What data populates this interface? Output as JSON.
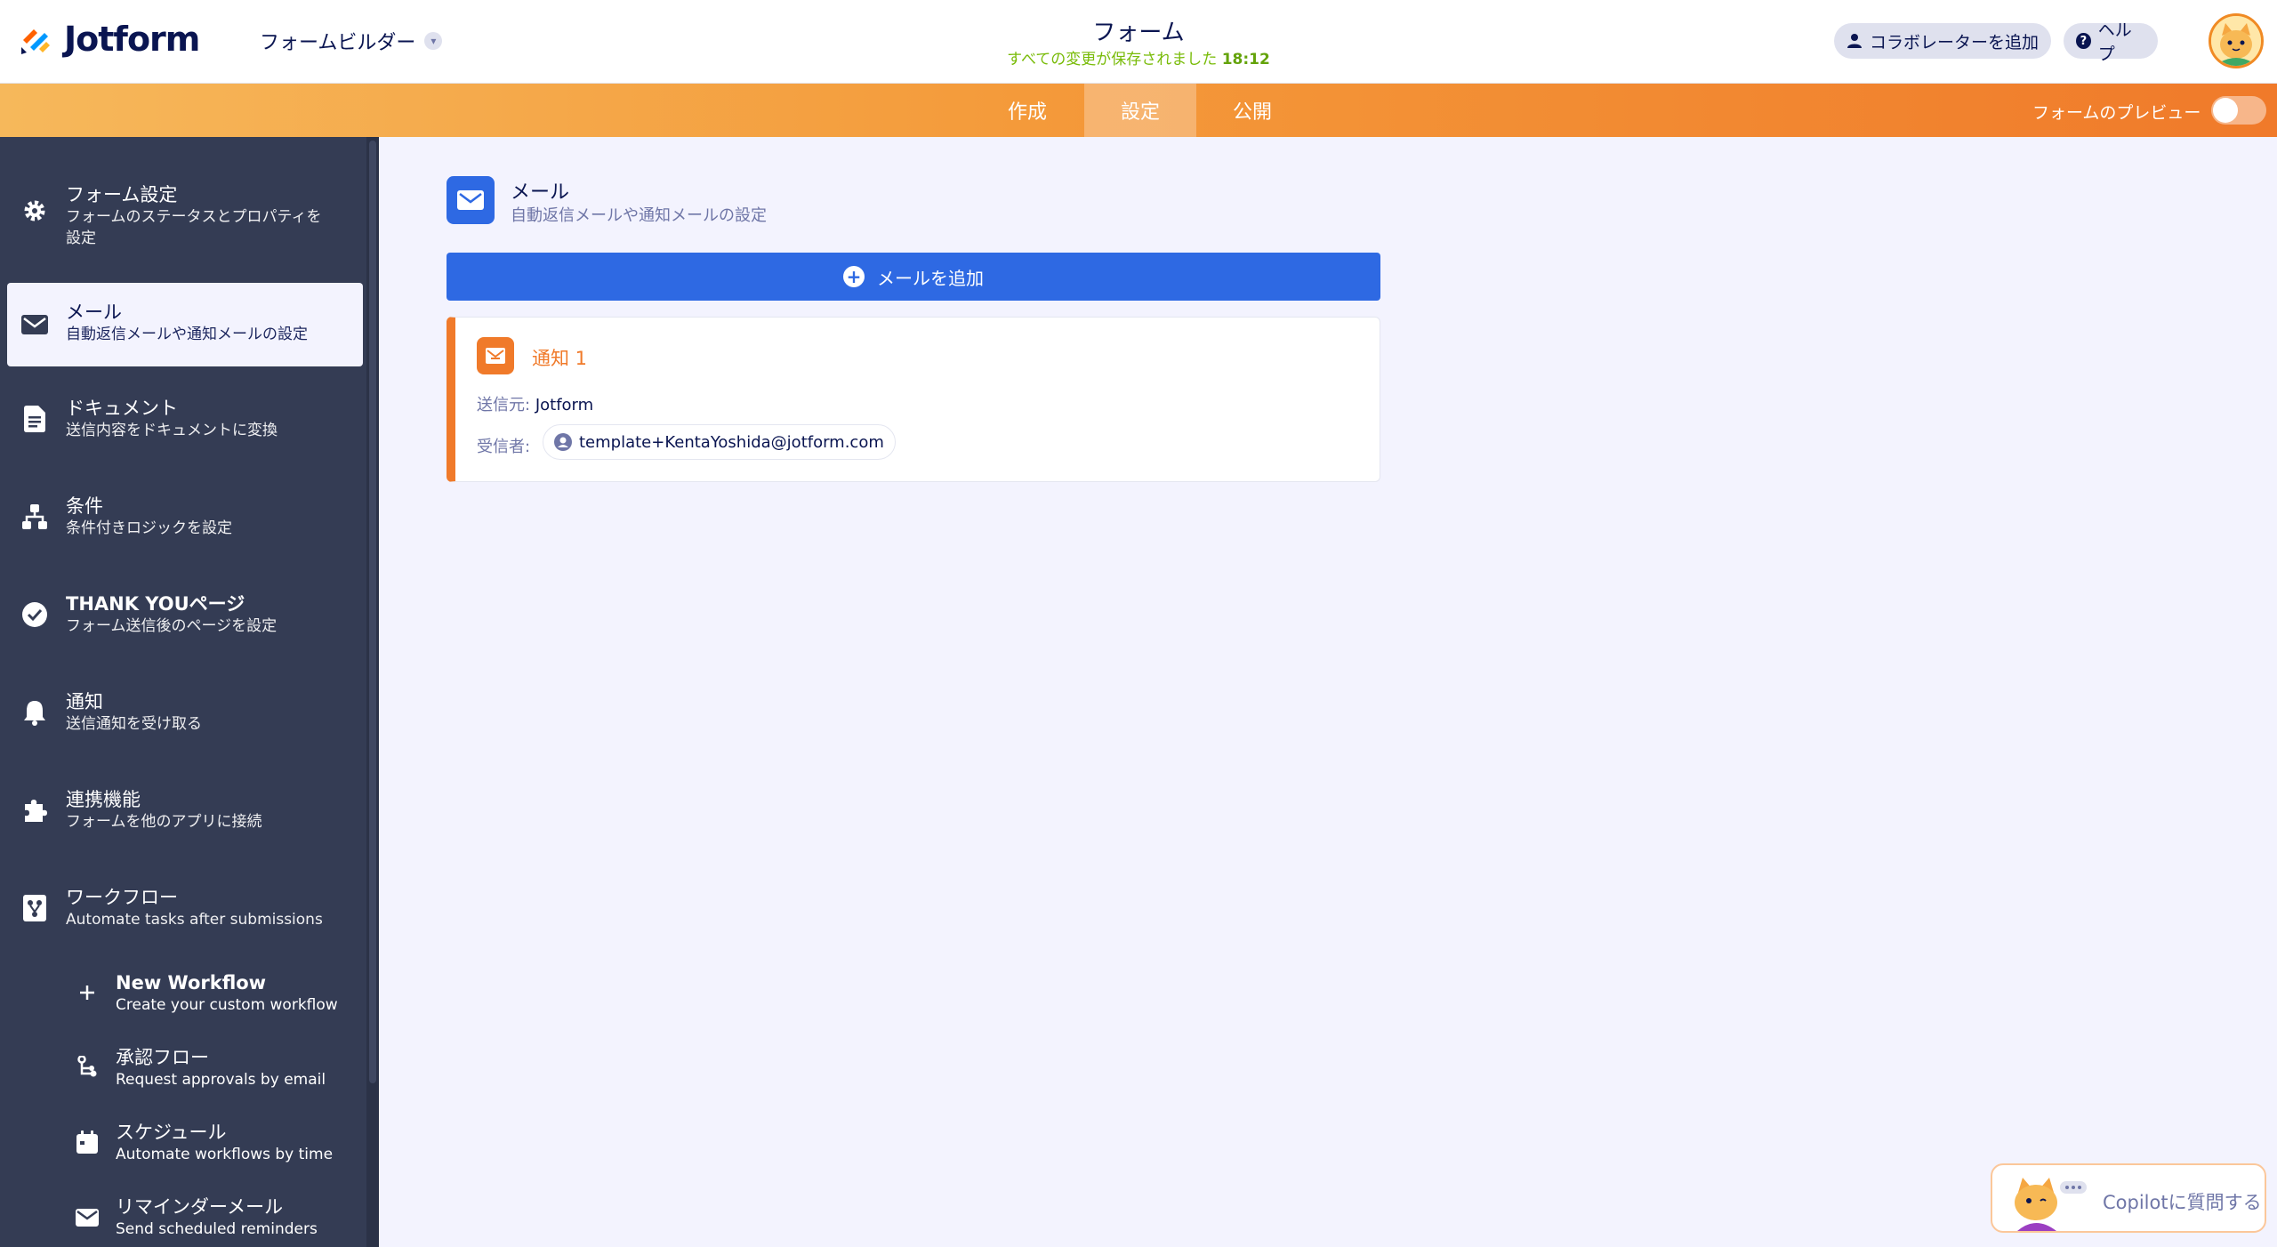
{
  "header": {
    "logo_text": "Jotform",
    "builder_label": "フォームビルダー",
    "form_title": "フォーム",
    "saved_text": "すべての変更が保存されました",
    "saved_time": "18:12",
    "collaborator_label": "コラボレーターを追加",
    "help_label": "ヘルプ"
  },
  "tabs": {
    "create": "作成",
    "settings": "設定",
    "publish": "公開",
    "preview_label": "フォームのプレビュー"
  },
  "sidebar": {
    "items": [
      {
        "title": "フォーム設定",
        "subtitle_1": "フォームのステータスとプロパティを",
        "subtitle_2": "設定"
      },
      {
        "title": "メール",
        "subtitle": "自動返信メールや通知メールの設定"
      },
      {
        "title": "ドキュメント",
        "subtitle": "送信内容をドキュメントに変換"
      },
      {
        "title": "条件",
        "subtitle": "条件付きロジックを設定"
      },
      {
        "title": "THANK YOUページ",
        "subtitle": "フォーム送信後のページを設定"
      },
      {
        "title": "通知",
        "subtitle": "送信通知を受け取る"
      },
      {
        "title": "連携機能",
        "subtitle": "フォームを他のアプリに接続"
      },
      {
        "title": "ワークフロー",
        "subtitle": "Automate tasks after submissions"
      }
    ],
    "sub_items": [
      {
        "title": "New Workflow",
        "subtitle": "Create your custom workflow"
      },
      {
        "title": "承認フロー",
        "subtitle": "Request approvals by email"
      },
      {
        "title": "スケジュール",
        "subtitle": "Automate workflows by time"
      },
      {
        "title": "リマインダーメール",
        "subtitle": "Send scheduled reminders"
      }
    ]
  },
  "main": {
    "section_title": "メール",
    "section_subtitle": "自動返信メールや通知メールの設定",
    "add_email_label": "メールを追加",
    "card": {
      "title": "通知 1",
      "from_label": "送信元:",
      "from_value": "Jotform",
      "to_label": "受信者:",
      "recipient": "template+KentaYoshida@jotform.com"
    }
  },
  "copilot": {
    "label": "Copilotに質問する"
  },
  "colors": {
    "brand_orange": "#f07a2a",
    "accent_blue": "#2e69e3",
    "sidebar_bg": "#343c54",
    "saved_green": "#78bb07"
  }
}
